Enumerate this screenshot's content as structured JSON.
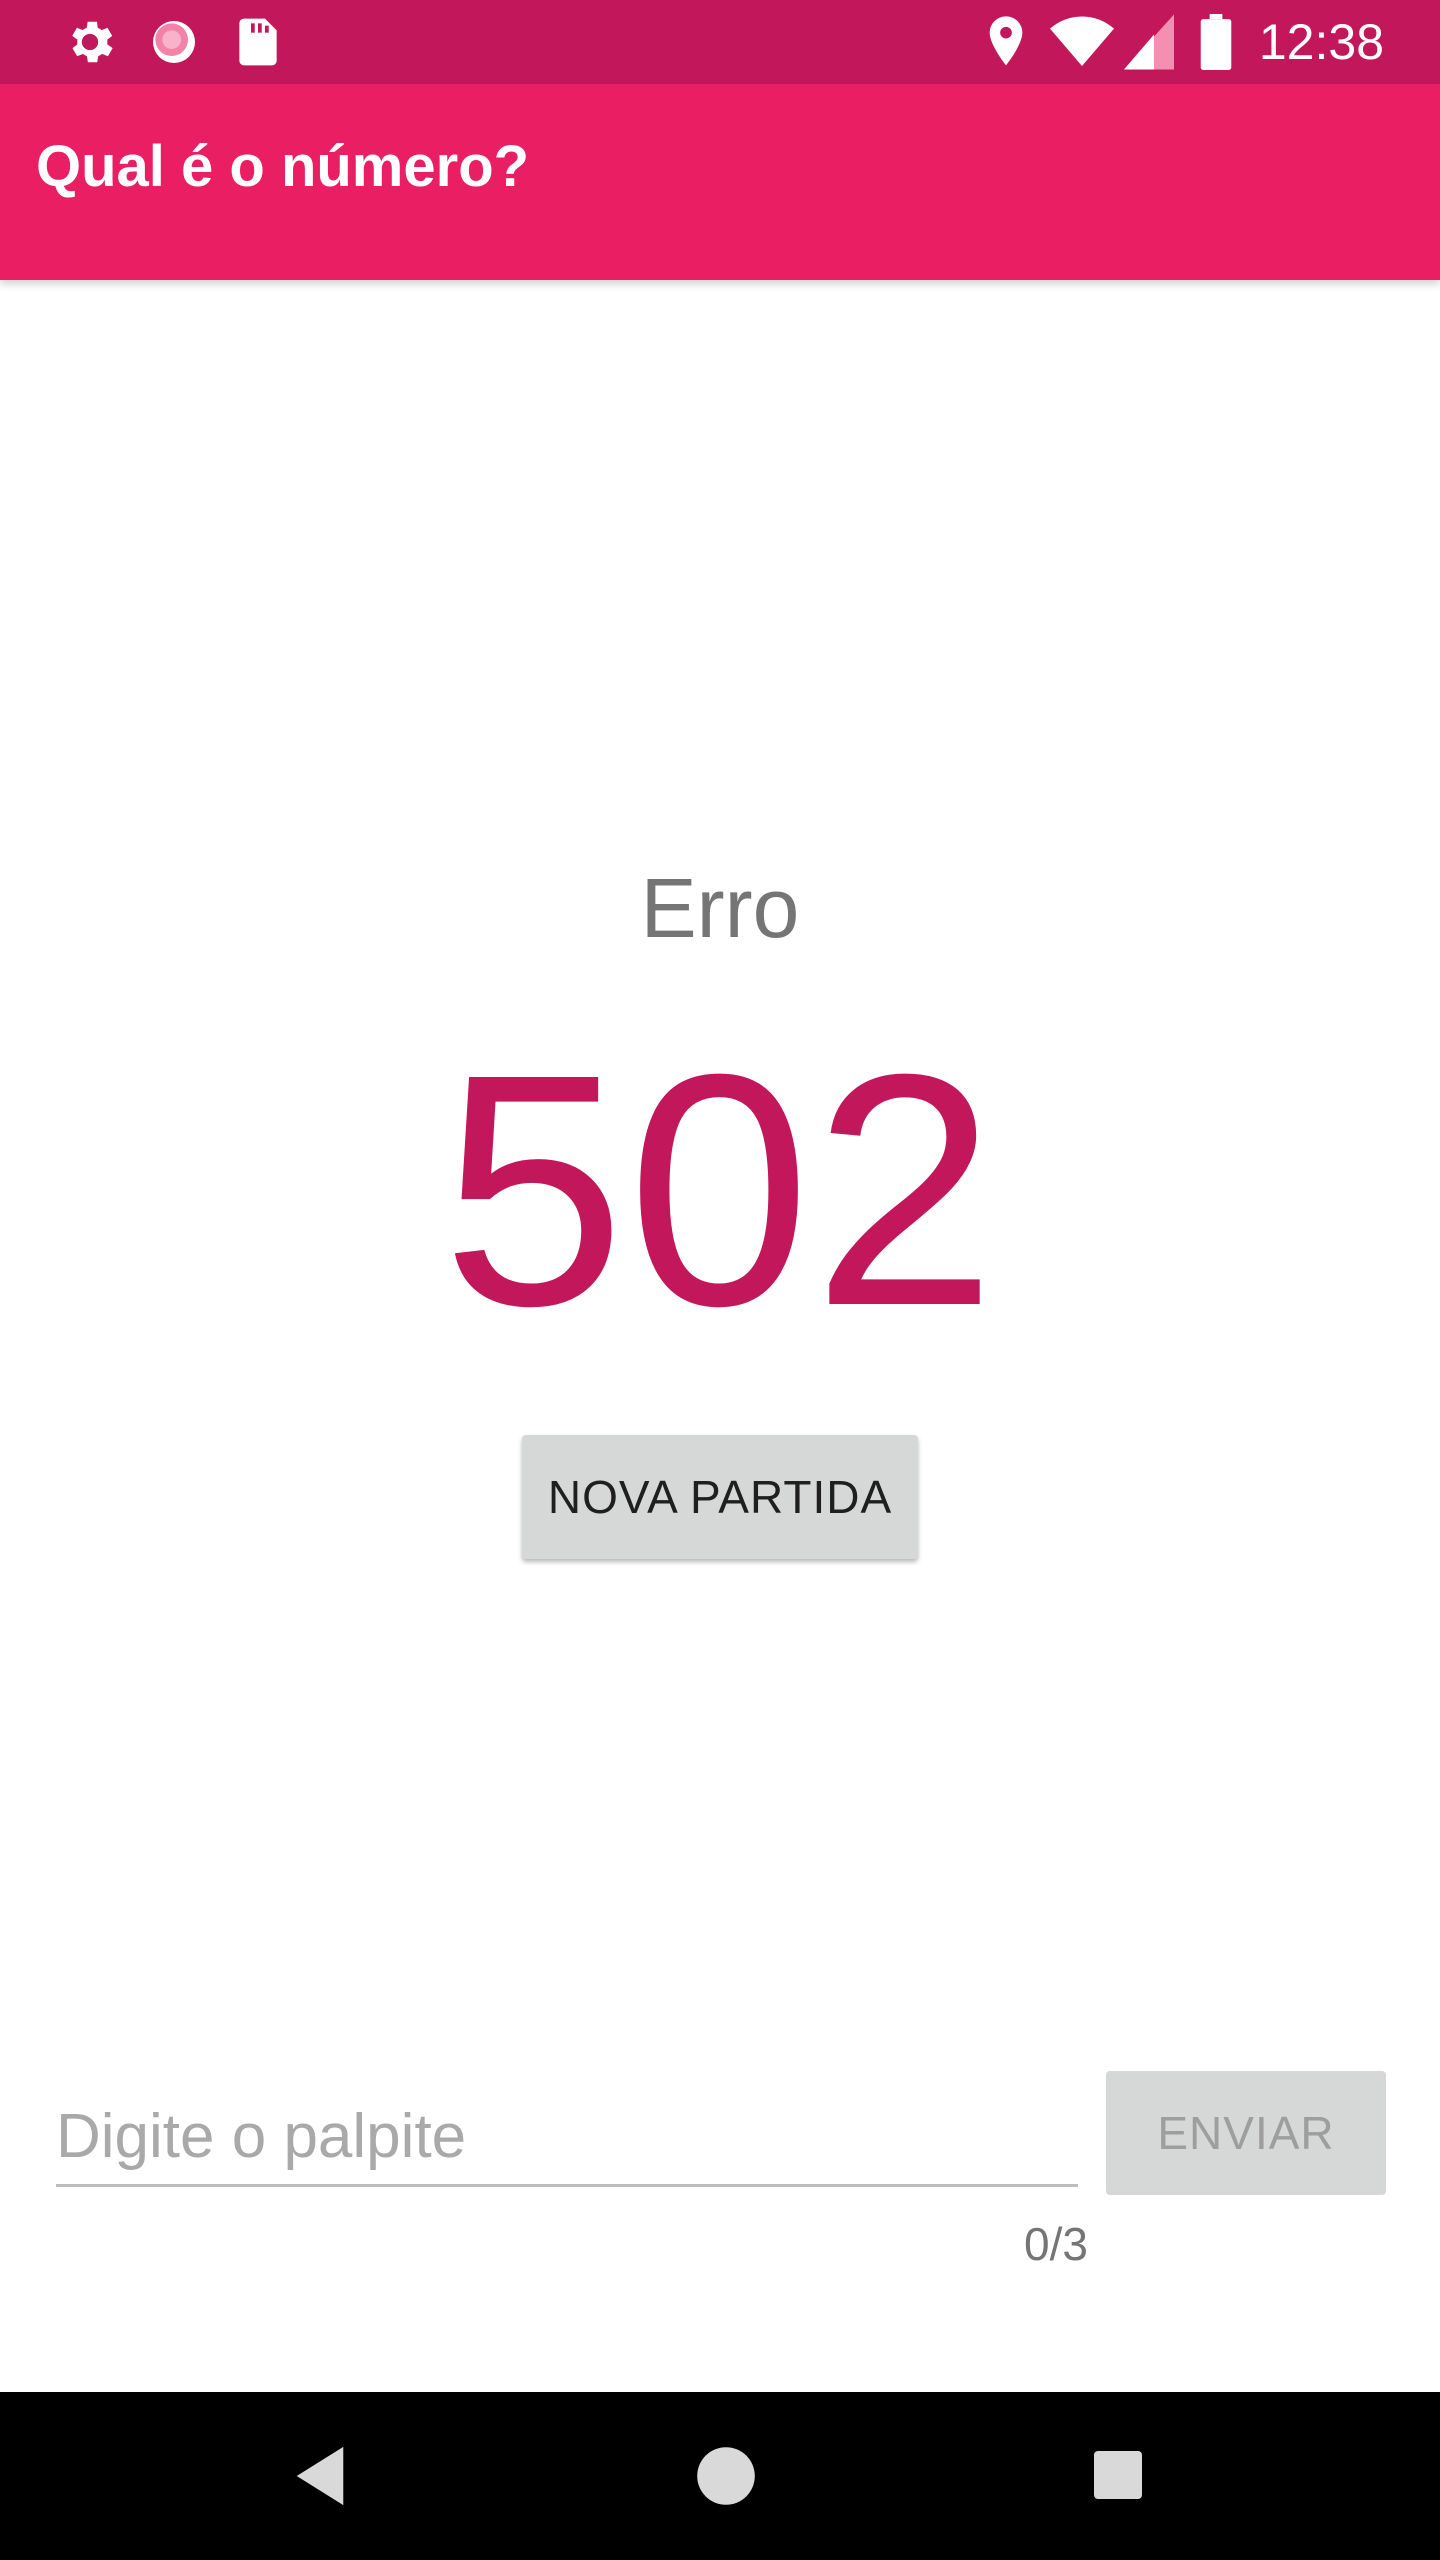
{
  "status_bar": {
    "time": "12:38",
    "left_icons": [
      "gear-icon",
      "sync-icon",
      "sd-card-icon"
    ],
    "right_icons": [
      "location-icon",
      "wifi-icon",
      "signal-icon",
      "battery-icon"
    ]
  },
  "app_bar": {
    "title": "Qual é o número?",
    "color": "#e91e63"
  },
  "main": {
    "status_label": "Erro",
    "number": "502",
    "number_color": "#c2185b",
    "new_game_label": "NOVA PARTIDA"
  },
  "input_row": {
    "guess_placeholder": "Digite o palpite",
    "guess_value": "",
    "char_counter": "0/3",
    "send_label": "ENVIAR"
  },
  "nav_bar": {
    "buttons": [
      "back-icon",
      "home-icon",
      "recents-icon"
    ]
  }
}
